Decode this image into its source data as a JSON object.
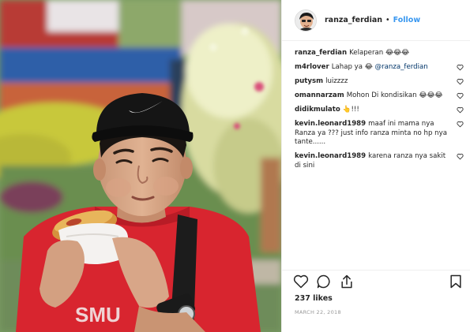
{
  "header": {
    "username": "ranza_ferdian",
    "separator": "•",
    "follow_label": "Follow"
  },
  "caption": {
    "username": "ranza_ferdian",
    "text": "Kelaperan 😂😂😂"
  },
  "comments": [
    {
      "username": "m4rlover",
      "text": "Lahap ya 😂 ",
      "mention": "@ranza_ferdian"
    },
    {
      "username": "putysm",
      "text": "luizzzz"
    },
    {
      "username": "omannarzam",
      "text": "Mohon Di kondisikan 😂😂😂"
    },
    {
      "username": "didikmulato",
      "text": "👆!!!"
    },
    {
      "username": "kevin.leonard1989",
      "text": "maaf ini mama nya Ranza ya ??? just info ranza minta no hp nya tante......"
    },
    {
      "username": "kevin.leonard1989",
      "text": "karena ranza nya sakit di sini"
    }
  ],
  "footer": {
    "likes": "237 likes",
    "date": "March 22, 2018"
  },
  "icons": {
    "heart": "heart-icon",
    "comment": "comment-bubble-icon",
    "share": "share-icon",
    "save": "bookmark-icon"
  },
  "colors": {
    "link_blue": "#3897f0",
    "mention": "#003569",
    "shirt_red": "#d8252f",
    "text": "#262626",
    "muted": "#999999"
  }
}
